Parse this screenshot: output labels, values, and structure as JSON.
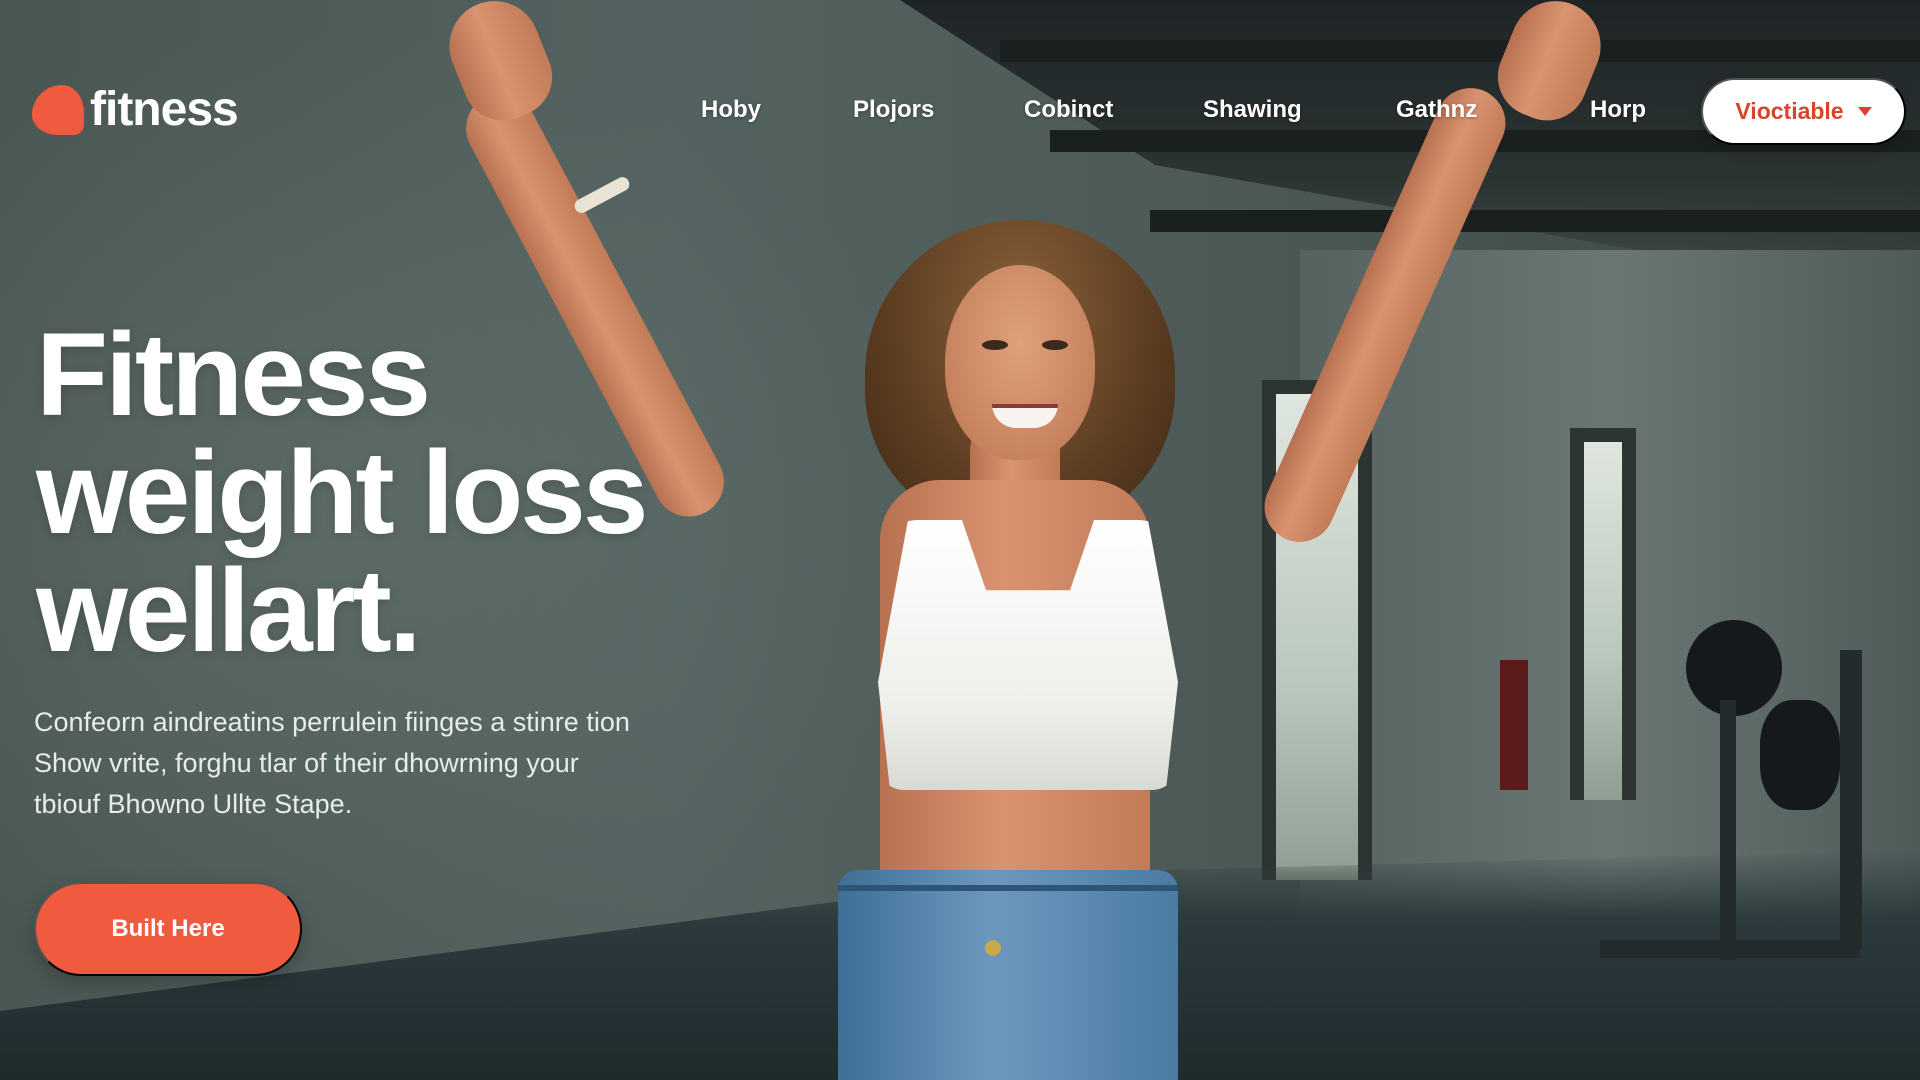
{
  "brand": {
    "name": "fitness",
    "accent_color": "#f05a3e",
    "logo_icon": "flame-logo-icon"
  },
  "nav": {
    "links": [
      "Hoby",
      "Plojors",
      "Cobinct",
      "Shawing",
      "Gathnz",
      "Horp"
    ],
    "cta_label": "Vioctiable",
    "cta_icon": "chevron-down-icon"
  },
  "hero": {
    "title_lines": [
      "Fitness",
      "weight loss",
      "wellart."
    ],
    "copy_lines": [
      "Confeorn aindreatins perrulein fiinges a stinre tion",
      "Show vrite, forghu tlar of their dhowrning your",
      "tbiouf Bhowno Ullte Stape."
    ],
    "button_label": "Built Here"
  }
}
